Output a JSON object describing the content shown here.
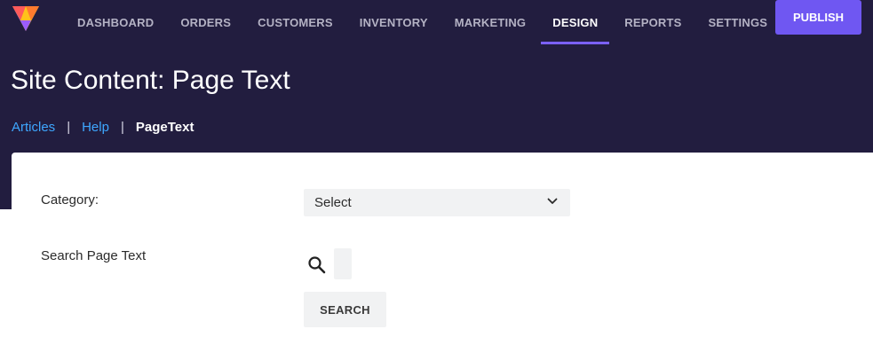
{
  "app": {
    "logo_icon": "prism-logo-icon"
  },
  "nav": {
    "items": [
      {
        "label": "DASHBOARD"
      },
      {
        "label": "ORDERS"
      },
      {
        "label": "CUSTOMERS"
      },
      {
        "label": "INVENTORY"
      },
      {
        "label": "MARKETING"
      },
      {
        "label": "DESIGN"
      },
      {
        "label": "REPORTS"
      },
      {
        "label": "SETTINGS"
      }
    ],
    "active": "DESIGN",
    "publish_label": "PUBLISH"
  },
  "header": {
    "title": "Site Content: Page Text",
    "breadcrumb": {
      "links": [
        "Articles",
        "Help"
      ],
      "separator": "|",
      "current": "PageText"
    }
  },
  "form": {
    "category_label": "Category:",
    "category_value": "Select",
    "search_label": "Search Page Text",
    "search_value": "",
    "search_button": "SEARCH"
  },
  "colors": {
    "header_bg": "#221d3f",
    "accent": "#6f57f2",
    "link": "#3ea7ff",
    "field_bg": "#f1f2f3"
  }
}
